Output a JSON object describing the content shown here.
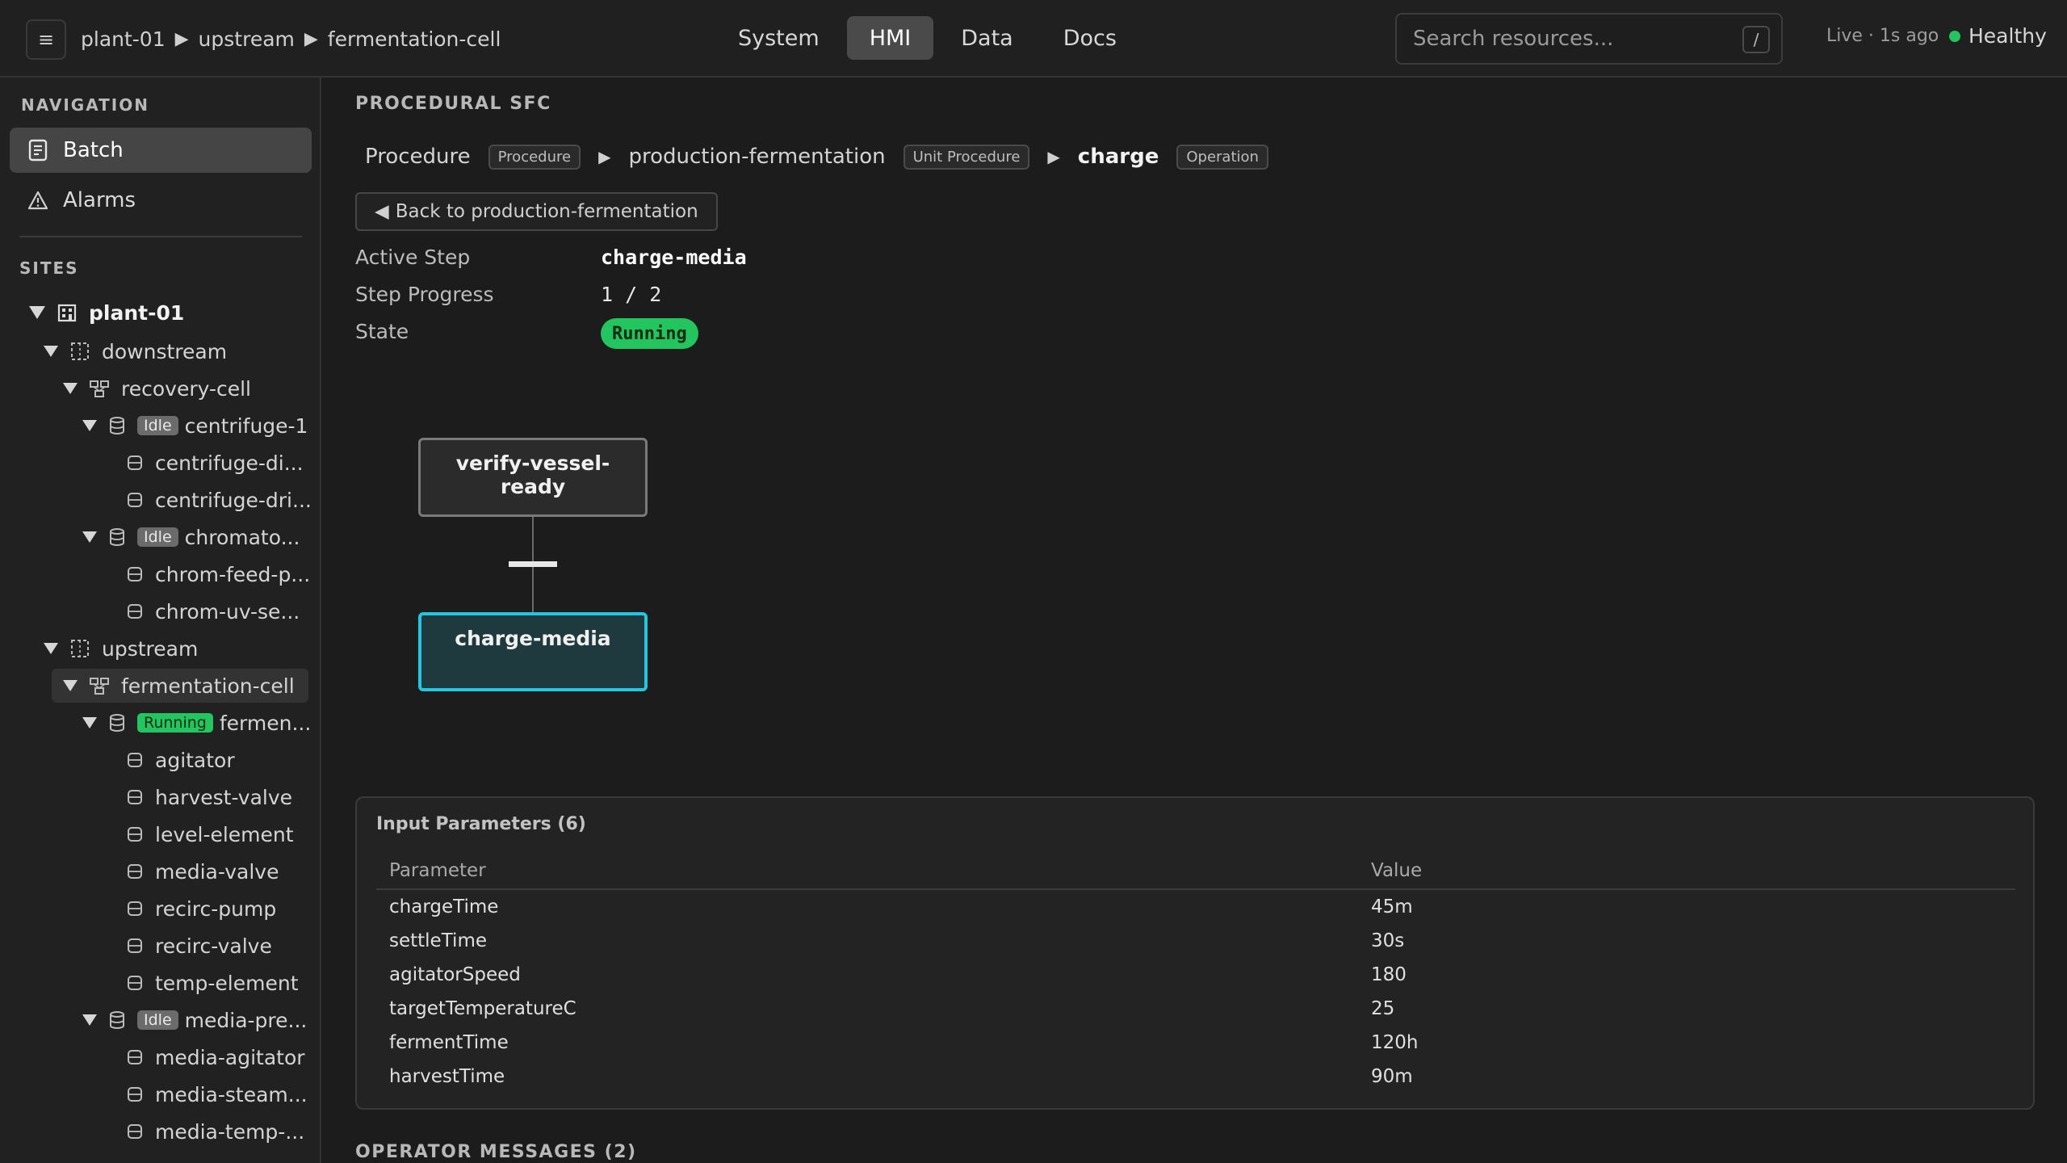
{
  "header": {
    "menu_glyph": "≡",
    "breadcrumb": [
      "plant-01",
      "upstream",
      "fermentation-cell"
    ],
    "tabs": [
      {
        "label": "System",
        "active": false
      },
      {
        "label": "HMI",
        "active": true
      },
      {
        "label": "Data",
        "active": false
      },
      {
        "label": "Docs",
        "active": false
      }
    ],
    "search": {
      "placeholder": "Search resources...",
      "shortcut": "/"
    },
    "live": "Live · 1s ago",
    "health": "Healthy",
    "health_color": "#22c55e"
  },
  "sidebar": {
    "nav_title": "NAVIGATION",
    "nav_items": [
      {
        "label": "Batch",
        "icon": "document-icon",
        "active": true
      },
      {
        "label": "Alarms",
        "icon": "warning-icon",
        "active": false
      }
    ],
    "sites_title": "SITES",
    "tree": [
      {
        "label": "plant-01",
        "icon": "building-icon",
        "depth": 0,
        "expanded": true,
        "bold": true
      },
      {
        "label": "downstream",
        "icon": "area-icon",
        "depth": 1,
        "expanded": true
      },
      {
        "label": "recovery-cell",
        "icon": "cell-icon",
        "depth": 2,
        "expanded": true
      },
      {
        "label": "centrifuge-1",
        "icon": "unit-icon",
        "depth": 3,
        "expanded": true,
        "badge": "Idle"
      },
      {
        "label": "centrifuge-di...",
        "icon": "equipment-icon",
        "depth": 4
      },
      {
        "label": "centrifuge-dri...",
        "icon": "equipment-icon",
        "depth": 4
      },
      {
        "label": "chromato...",
        "icon": "unit-icon",
        "depth": 3,
        "expanded": true,
        "badge": "Idle"
      },
      {
        "label": "chrom-feed-p...",
        "icon": "equipment-icon",
        "depth": 4
      },
      {
        "label": "chrom-uv-se...",
        "icon": "equipment-icon",
        "depth": 4
      },
      {
        "label": "upstream",
        "icon": "area-icon",
        "depth": 1,
        "expanded": true
      },
      {
        "label": "fermentation-cell",
        "icon": "cell-icon",
        "depth": 2,
        "expanded": true,
        "selected": true
      },
      {
        "label": "fermen...",
        "icon": "unit-icon",
        "depth": 3,
        "expanded": true,
        "badge": "Running"
      },
      {
        "label": "agitator",
        "icon": "equipment-icon",
        "depth": 4
      },
      {
        "label": "harvest-valve",
        "icon": "equipment-icon",
        "depth": 4
      },
      {
        "label": "level-element",
        "icon": "equipment-icon",
        "depth": 4
      },
      {
        "label": "media-valve",
        "icon": "equipment-icon",
        "depth": 4
      },
      {
        "label": "recirc-pump",
        "icon": "equipment-icon",
        "depth": 4
      },
      {
        "label": "recirc-valve",
        "icon": "equipment-icon",
        "depth": 4
      },
      {
        "label": "temp-element",
        "icon": "equipment-icon",
        "depth": 4
      },
      {
        "label": "media-pre...",
        "icon": "unit-icon",
        "depth": 3,
        "expanded": true,
        "badge": "Idle"
      },
      {
        "label": "media-agitator",
        "icon": "equipment-icon",
        "depth": 4
      },
      {
        "label": "media-steam...",
        "icon": "equipment-icon",
        "depth": 4
      },
      {
        "label": "media-temp-...",
        "icon": "equipment-icon",
        "depth": 4
      }
    ]
  },
  "main": {
    "title": "PROCEDURAL SFC",
    "procedure_path": [
      {
        "name": "Procedure",
        "type": "Procedure",
        "current": false
      },
      {
        "name": "production-fermentation",
        "type": "Unit Procedure",
        "current": false
      },
      {
        "name": "charge",
        "type": "Operation",
        "current": true
      }
    ],
    "back_label": "Back to production-fermentation",
    "active_step_label": "Active Step",
    "active_step": "charge-media",
    "progress_label": "Step Progress",
    "progress": "1 / 2",
    "state_label": "State",
    "state": "Running",
    "state_color": "#22c55e",
    "sfc": {
      "steps": [
        {
          "name": "verify-vessel-ready",
          "display": "verify-vessel-\nready",
          "active": false
        },
        {
          "name": "charge-media",
          "display": "charge-media",
          "active": true
        }
      ],
      "active_color": "#22c7e0"
    },
    "params": {
      "title": "Input Parameters (6)",
      "columns": [
        "Parameter",
        "Value"
      ],
      "rows": [
        [
          "chargeTime",
          "45m"
        ],
        [
          "settleTime",
          "30s"
        ],
        [
          "agitatorSpeed",
          "180"
        ],
        [
          "targetTemperatureC",
          "25"
        ],
        [
          "fermentTime",
          "120h"
        ],
        [
          "harvestTime",
          "90m"
        ]
      ]
    },
    "operator_messages_title": "OPERATOR MESSAGES (2)"
  }
}
